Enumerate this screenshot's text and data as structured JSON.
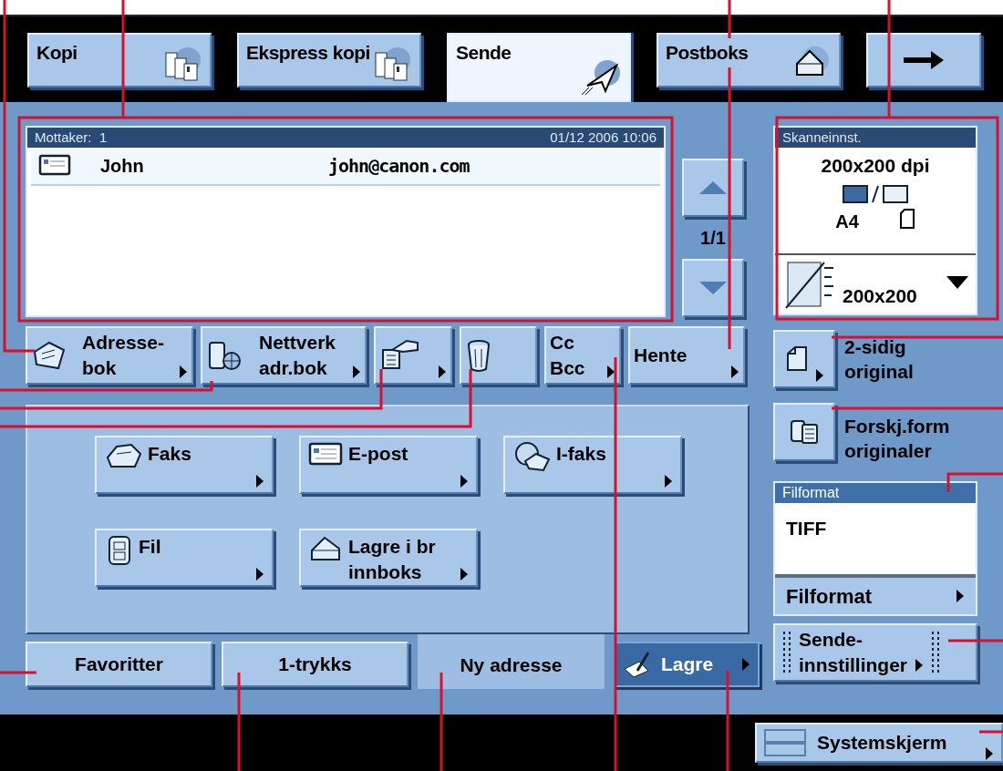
{
  "tabs": [
    {
      "label": "Kopi",
      "selected": false
    },
    {
      "label": "Ekspress kopi",
      "selected": false
    },
    {
      "label": "Sende",
      "selected": true
    },
    {
      "label": "Postboks",
      "selected": false
    }
  ],
  "recipient_list": {
    "header": "Mottaker:",
    "count": "1",
    "datetime": "01/12 2006 10:06",
    "rows": [
      {
        "name": "John",
        "address": "john@canon.com"
      }
    ],
    "page": "1/1"
  },
  "scan_settings": {
    "title": "Skanneinnst.",
    "resolution": "200x200 dpi",
    "paper_size": "A4",
    "button_label": "200x200"
  },
  "address_buttons": [
    {
      "lines": [
        "Adresse-",
        "bok"
      ],
      "menu": true
    },
    {
      "lines": [
        "Nettverk",
        "adr.bok"
      ],
      "menu": true
    },
    {
      "menu": true
    },
    {
      "menu": false
    },
    {
      "lines": [
        "Cc",
        "Bcc"
      ],
      "menu": true
    },
    {
      "lines": [
        "Hente"
      ],
      "menu": true
    }
  ],
  "destinations": [
    {
      "lines": [
        "Faks"
      ]
    },
    {
      "lines": [
        "E-post"
      ]
    },
    {
      "lines": [
        "I-faks"
      ]
    },
    {
      "lines": [
        "Fil"
      ]
    },
    {
      "lines": [
        "Lagre i br",
        "innboks"
      ]
    }
  ],
  "bottom_tabs": [
    {
      "label": "Favoritter",
      "selected": false
    },
    {
      "label": "1-trykks",
      "selected": false
    },
    {
      "label": "Ny adresse",
      "selected": true
    }
  ],
  "save_button": {
    "label": "Lagre"
  },
  "original_options": [
    {
      "lines": [
        "2-sidig",
        "original"
      ]
    },
    {
      "lines": [
        "Forskj.form",
        "originaler"
      ]
    }
  ],
  "file_format": {
    "title": "Filformat",
    "value": "TIFF",
    "button_label": "Filformat"
  },
  "send_settings": {
    "lines": [
      "Sende-",
      "innstillinger"
    ]
  },
  "system_button": {
    "label": "Systemskjerm"
  }
}
